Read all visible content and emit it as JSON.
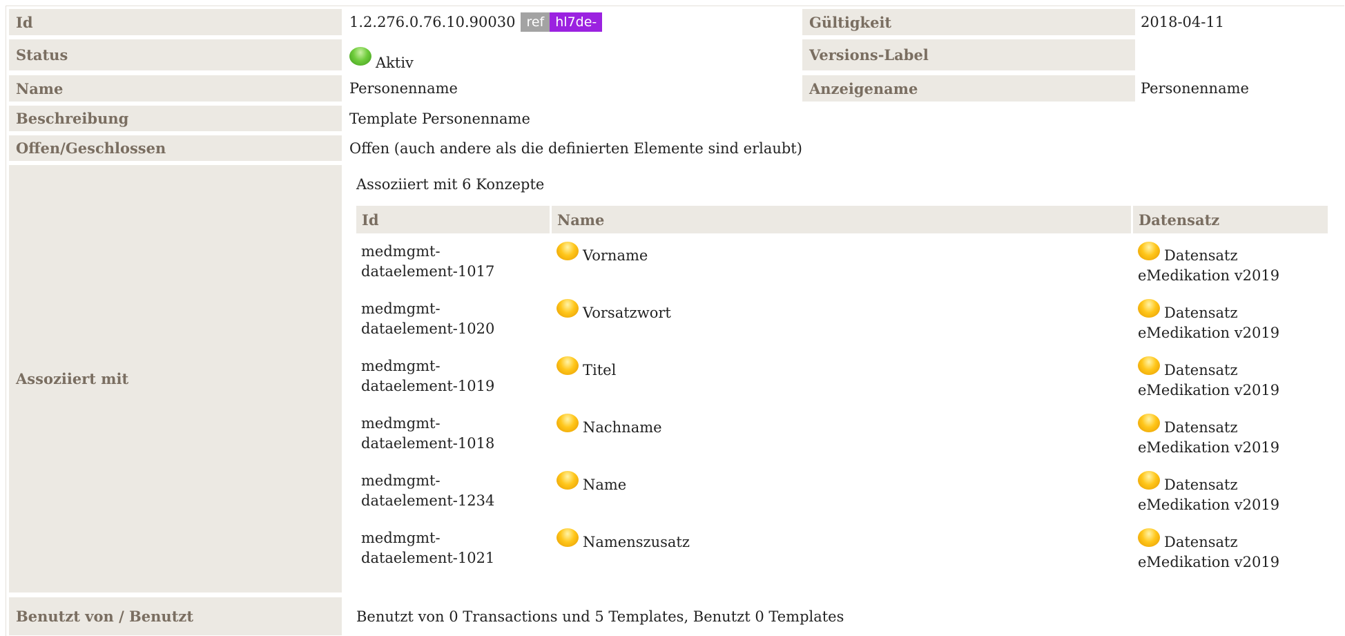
{
  "labels": {
    "id": "Id",
    "status": "Status",
    "name": "Name",
    "beschreibung": "Beschreibung",
    "offen": "Offen/Geschlossen",
    "assoziiert": "Assoziiert mit",
    "benutzt": "Benutzt von / Benutzt",
    "gueltigkeit": "Gültigkeit",
    "versions_label": "Versions-Label",
    "anzeigename": "Anzeigename"
  },
  "values": {
    "id": "1.2.276.0.76.10.90030",
    "ref_badge": "ref",
    "hl7_badge": "hl7de-",
    "status": "Aktiv",
    "name": "Personenname",
    "beschreibung": "Template Personenname",
    "offen": "Offen (auch andere als die definierten Elemente sind erlaubt)",
    "gueltigkeit": "2018-04-11",
    "versions_label": "",
    "anzeigename": "Personenname",
    "benutzt": "Benutzt von 0 Transactions und 5 Templates, Benutzt 0 Templates"
  },
  "concepts": {
    "caption": "Assoziiert mit 6 Konzepte",
    "headers": {
      "id": "Id",
      "name": "Name",
      "datensatz": "Datensatz"
    },
    "rows": [
      {
        "id1": "medmgmt-",
        "id2": "dataelement-1017",
        "name": "Vorname",
        "ds1": "Datensatz",
        "ds2": "eMedikation v2019"
      },
      {
        "id1": "medmgmt-",
        "id2": "dataelement-1020",
        "name": "Vorsatzwort",
        "ds1": "Datensatz",
        "ds2": "eMedikation v2019"
      },
      {
        "id1": "medmgmt-",
        "id2": "dataelement-1019",
        "name": "Titel",
        "ds1": "Datensatz",
        "ds2": "eMedikation v2019"
      },
      {
        "id1": "medmgmt-",
        "id2": "dataelement-1018",
        "name": "Nachname",
        "ds1": "Datensatz",
        "ds2": "eMedikation v2019"
      },
      {
        "id1": "medmgmt-",
        "id2": "dataelement-1234",
        "name": "Name",
        "ds1": "Datensatz",
        "ds2": "eMedikation v2019"
      },
      {
        "id1": "medmgmt-",
        "id2": "dataelement-1021",
        "name": "Namenszusatz",
        "ds1": "Datensatz",
        "ds2": "eMedikation v2019"
      }
    ]
  },
  "colors": {
    "label_bg": "#ece9e3",
    "label_text": "#7a6e61",
    "ref_badge": "#a3a3a3",
    "hl7_badge": "#9b22e0",
    "status_active": "green",
    "concept_status": "yellow"
  },
  "icons": {
    "status": "green-status-dot-icon",
    "concept": "yellow-status-dot-icon"
  }
}
